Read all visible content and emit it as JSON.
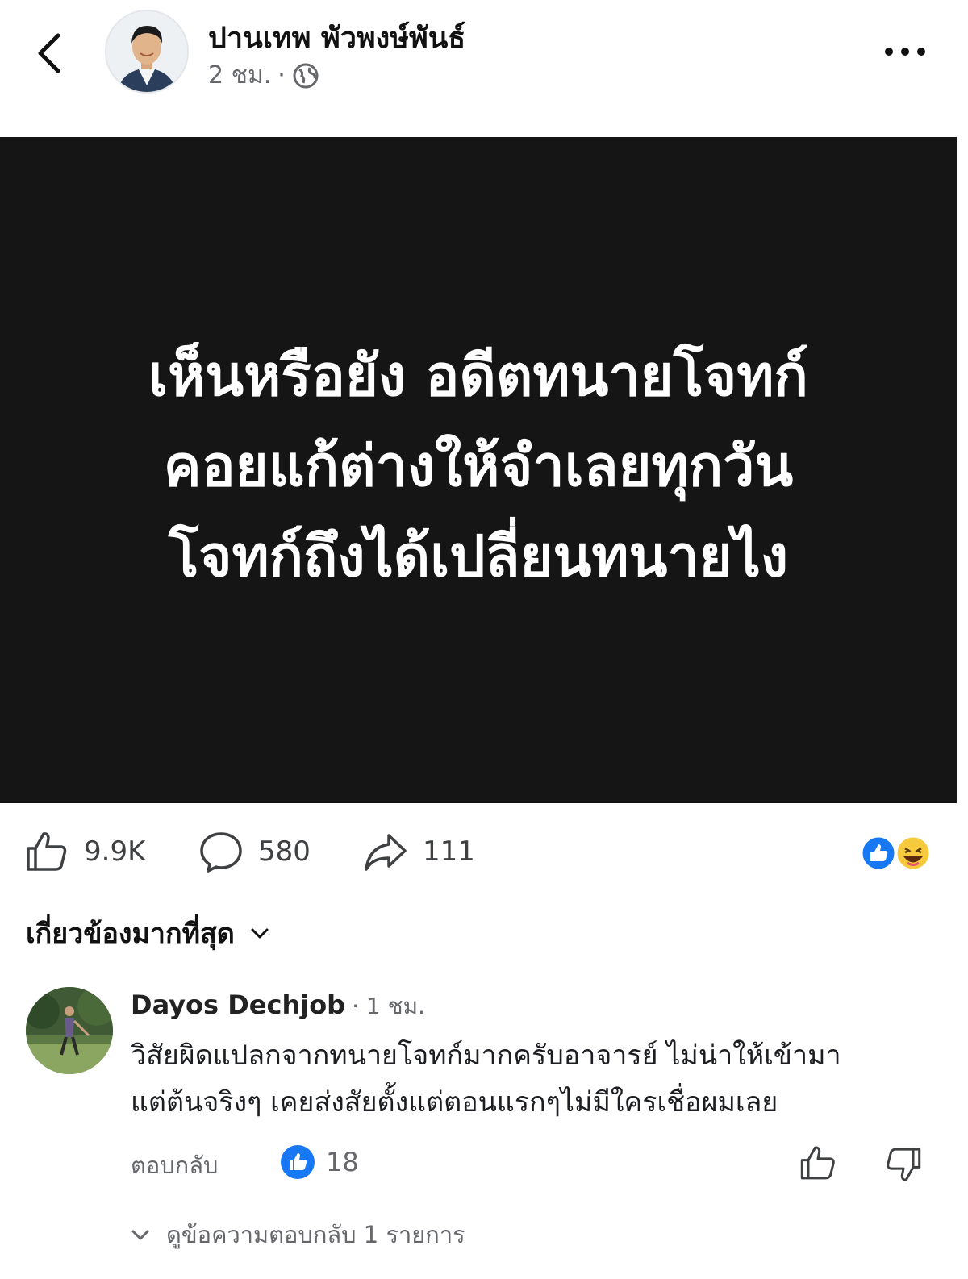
{
  "post": {
    "author": "ปานเทพ  พัวพงษ์พันธ์",
    "time": "2 ชม.",
    "separator": "·",
    "image_text": [
      "เห็นหรือยัง อดีตทนายโจทก์",
      "คอยแก้ต่างให้จำเลยทุกวัน",
      "โจทก์ถึงได้เปลี่ยนทนายไง"
    ],
    "likes": "9.9K",
    "comments": "580",
    "shares": "111"
  },
  "sort_label": "เกี่ยวข้องมากที่สุด",
  "comment": {
    "author": "Dayos Dechjob",
    "time": "· 1 ชม.",
    "lines": [
      "วิสัยผิดแปลกจากทนายโจทก์มากครับอาจารย์ ไม่น่าให้เข้ามา",
      "แต่ต้นจริงๆ  เคยส่งสัยตั้งแต่ตอนแรกๆไม่มีใครเชื่อผมเลย"
    ],
    "reply_label": "ตอบกลับ",
    "likes": "18",
    "view_replies": "ดูข้อความตอบกลับ 1 รายการ"
  },
  "colors": {
    "facebook_blue": "#1877f2",
    "image_background": "#151515",
    "secondary_text": "#65676b"
  },
  "icons": [
    "back-arrow-icon",
    "globe-icon",
    "more-icon",
    "like-icon",
    "comment-icon",
    "share-icon",
    "like-reaction-icon",
    "haha-reaction-icon",
    "chevron-down-icon",
    "thumbs-up-icon",
    "thumbs-down-icon"
  ]
}
